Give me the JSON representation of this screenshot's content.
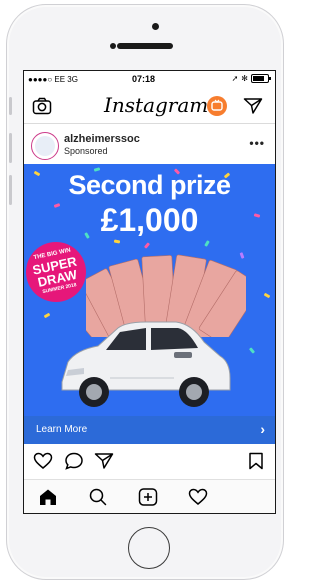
{
  "status_bar": {
    "carrier": "●●●●○ EE  3G",
    "time": "07:18",
    "right_icons": [
      "location-arrow-icon",
      "bluetooth-icon",
      "battery-icon"
    ]
  },
  "header": {
    "brand": "Instagram",
    "icons": [
      "camera-icon",
      "igtv-icon",
      "direct-send-icon"
    ]
  },
  "post": {
    "username": "alzheimerssoc",
    "subtitle": "Sponsored",
    "more_label": "•••",
    "ad": {
      "headline_line1": "Second prize",
      "headline_line2": "£1,000",
      "badge_line1": "THE BIG WIN",
      "badge_line2": "SUPER",
      "badge_line3": "DRAW",
      "badge_line4": "SUMMER 2018",
      "background_color": "#2e6df0",
      "badge_color": "#e6177a"
    },
    "cta_label": "Learn More",
    "cta_color": "#2c6ad8",
    "actions": [
      "heart-icon",
      "comment-icon",
      "share-icon",
      "bookmark-icon"
    ]
  },
  "tab_bar": {
    "items": [
      "home-icon",
      "search-icon",
      "add-post-icon",
      "activity-heart-icon"
    ]
  }
}
